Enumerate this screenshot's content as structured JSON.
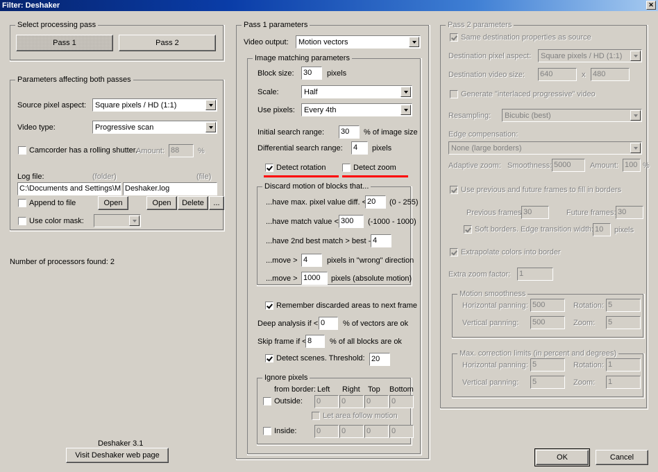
{
  "window": {
    "title": "Filter: Deshaker",
    "close_label": "✕"
  },
  "select_pass": {
    "legend": "Select processing pass",
    "pass1": "Pass 1",
    "pass2": "Pass 2"
  },
  "both_passes": {
    "legend": "Parameters affecting both passes",
    "source_pixel_aspect_label": "Source pixel aspect:",
    "source_pixel_aspect_value": "Square pixels / HD  (1:1)",
    "video_type_label": "Video type:",
    "video_type_value": "Progressive scan",
    "rolling_shutter_label": "Camcorder has a rolling shutter.",
    "rolling_amount_label": "Amount:",
    "rolling_amount_value": "88",
    "percent": "%",
    "log_file_label": "Log file:",
    "folder_hint": "(folder)",
    "file_hint": "(file)",
    "log_folder_value": "C:\\Documents and Settings\\M",
    "log_file_value": "Deshaker.log",
    "append_label": "Append to file",
    "open_folder": "Open",
    "open_file": "Open",
    "delete": "Delete",
    "ellipsis": "...",
    "color_mask_label": "Use color mask:",
    "color_mask_value": ""
  },
  "processors": "Number of processors found:  2",
  "footer": {
    "version": "Deshaker 3.1",
    "web_button": "Visit Deshaker web page",
    "ok": "OK",
    "cancel": "Cancel"
  },
  "pass1": {
    "legend": "Pass 1 parameters",
    "video_output_label": "Video output:",
    "video_output_value": "Motion vectors",
    "image_matching": {
      "legend": "Image matching parameters",
      "block_size_label": "Block size:",
      "block_size_value": "30",
      "block_size_unit": "pixels",
      "scale_label": "Scale:",
      "scale_value": "Half",
      "use_pixels_label": "Use pixels:",
      "use_pixels_value": "Every 4th",
      "initial_search_label": "Initial search range:",
      "initial_search_value": "30",
      "initial_search_unit": "% of image size",
      "differential_search_label": "Differential search range:",
      "differential_search_value": "4",
      "differential_search_unit": "pixels",
      "detect_rotation": "Detect rotation",
      "detect_zoom": "Detect zoom",
      "discard": {
        "legend": "Discard motion of blocks that...",
        "r1_label": "...have max. pixel value diff. <",
        "r1_value": "20",
        "r1_range": "(0 - 255)",
        "r2_label": "...have match value <",
        "r2_value": "300",
        "r2_range": "(-1000 - 1000)",
        "r3_label": "...have 2nd best match > best -",
        "r3_value": "4",
        "r4_label": "...move >",
        "r4_value": "4",
        "r4_unit": "pixels in \"wrong\" direction",
        "r5_label": "...move >",
        "r5_value": "1000",
        "r5_unit": "pixels (absolute motion)"
      },
      "remember_label": "Remember discarded areas to next frame",
      "deep_analysis_label": "Deep analysis if <",
      "deep_analysis_value": "0",
      "deep_analysis_unit": "% of vectors are ok",
      "skip_frame_label": "Skip frame if <",
      "skip_frame_value": "8",
      "skip_frame_unit": "% of all blocks are ok",
      "detect_scenes_label": "Detect scenes. Threshold:",
      "detect_scenes_value": "20",
      "ignore": {
        "legend": "Ignore pixels",
        "from_border": "from border:",
        "col_left": "Left",
        "col_right": "Right",
        "col_top": "Top",
        "col_bottom": "Bottom",
        "outside_label": "Outside:",
        "outside_values": [
          "0",
          "0",
          "0",
          "0"
        ],
        "follow_motion_label": "Let area follow motion",
        "inside_label": "Inside:",
        "inside_values": [
          "0",
          "0",
          "0",
          "0"
        ]
      }
    }
  },
  "pass2": {
    "legend": "Pass 2 parameters",
    "same_dest_label": "Same destination properties as source",
    "dest_pixel_aspect_label": "Destination pixel aspect:",
    "dest_pixel_aspect_value": "Square pixels / HD  (1:1)",
    "dest_video_size_label": "Destination video size:",
    "dest_w": "640",
    "dest_x": "x",
    "dest_h": "480",
    "interlaced_label": "Generate \"interlaced progressive\" video",
    "resampling_label": "Resampling:",
    "resampling_value": "Bicubic  (best)",
    "edge_comp_label": "Edge compensation:",
    "edge_comp_value": "None  (large borders)",
    "adaptive_zoom_label": "Adaptive zoom:",
    "smoothness_label": "Smoothness:",
    "smoothness_value": "5000",
    "amount_label": "Amount:",
    "amount_value": "100",
    "percent": "%",
    "use_frames_label": "Use previous and future frames to fill in borders",
    "prev_frames_label": "Previous frames:",
    "prev_frames_value": "30",
    "future_frames_label": "Future frames:",
    "future_frames_value": "30",
    "soft_borders_label": "Soft borders. Edge transition width:",
    "soft_borders_value": "10",
    "soft_borders_unit": "pixels",
    "extrapolate_label": "Extrapolate colors into border",
    "extra_zoom_label": "Extra zoom factor:",
    "extra_zoom_value": "1",
    "motion_smoothness": {
      "legend": "Motion smoothness",
      "hpan_label": "Horizontal panning:",
      "hpan_value": "500",
      "rot_label": "Rotation:",
      "rot_value": "5",
      "vpan_label": "Vertical panning:",
      "vpan_value": "500",
      "zoom_label": "Zoom:",
      "zoom_value": "5"
    },
    "max_correction": {
      "legend": "Max. correction limits (in percent and degrees)",
      "hpan_label": "Horizontal panning:",
      "hpan_value": "5",
      "rot_label": "Rotation:",
      "rot_value": "1",
      "vpan_label": "Vertical panning:",
      "vpan_value": "5",
      "zoom_label": "Zoom:",
      "zoom_value": "1"
    }
  }
}
